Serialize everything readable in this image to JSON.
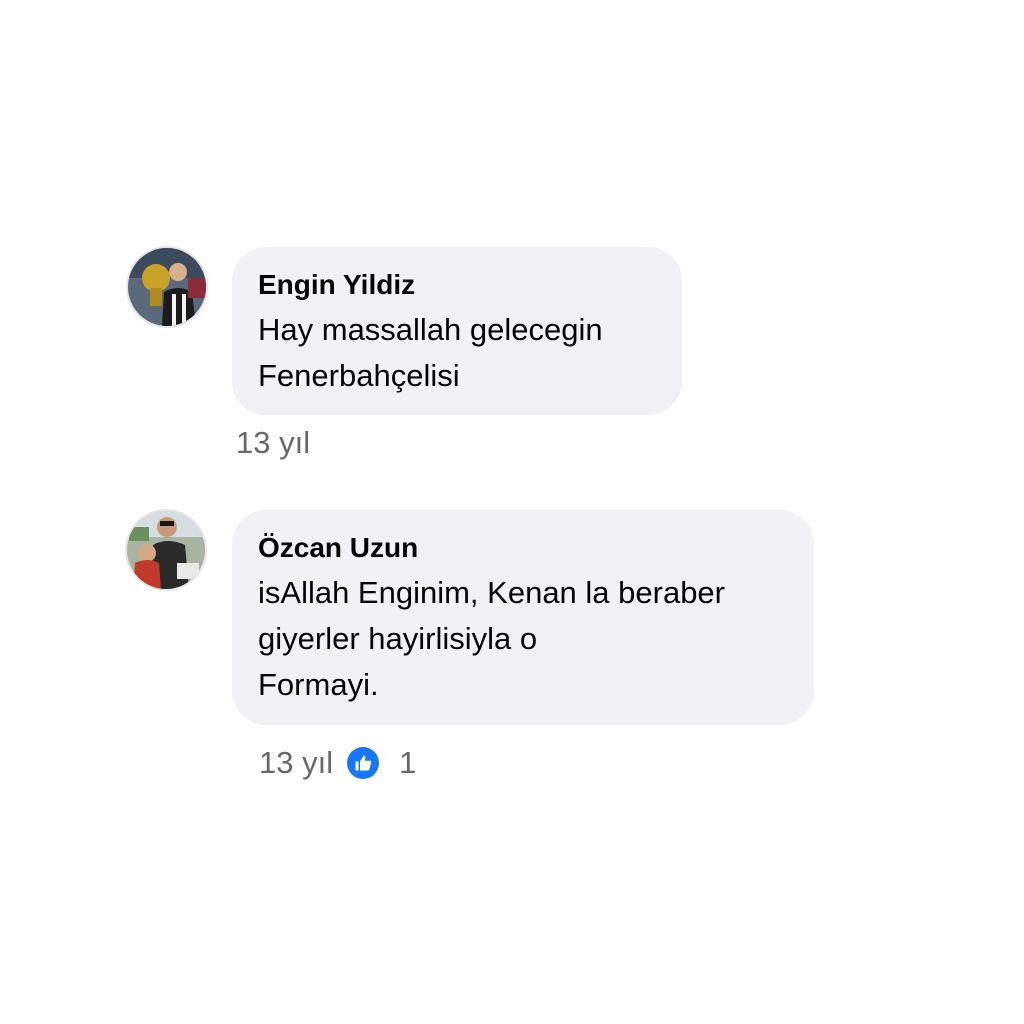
{
  "comments": [
    {
      "author": "Engin Yildiz",
      "lines": [
        "Hay massallah gelecegin",
        "Fenerbahçelisi"
      ],
      "time": "13 yıl",
      "avatar_icon": "profile-photo-trophy"
    },
    {
      "author": "Özcan Uzun",
      "lines": [
        "isAllah Enginim, Kenan la beraber",
        "giyerler hayirlisiyla o",
        "Formayi."
      ],
      "time": "13 yıl",
      "reaction_icon": "like-icon",
      "reaction_count": "1",
      "avatar_icon": "profile-photo-family"
    }
  ],
  "colors": {
    "bubble": "#f0f2f5",
    "text": "#050505",
    "meta": "#65676b",
    "like": "#1877f2"
  }
}
